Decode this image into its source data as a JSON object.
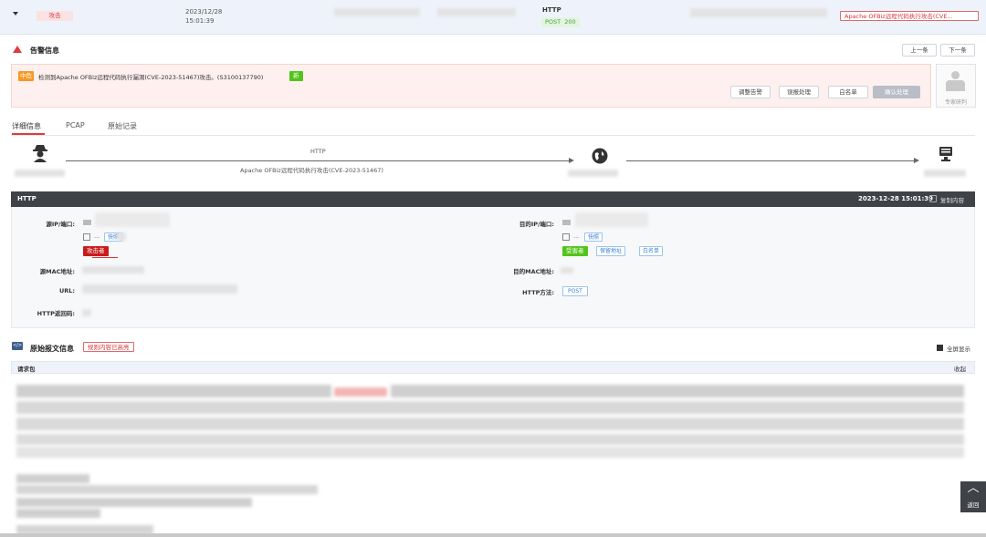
{
  "header_row": {
    "type_badge": "攻击",
    "date": "2023/12/28",
    "time": "15:01:39",
    "protocol": "HTTP",
    "method_status": "POST  200",
    "alert_name": "Apache OFBiz远程代码执行攻击(CVE..."
  },
  "alert": {
    "section_title": "告警信息",
    "prev_label": "上一条",
    "next_label": "下一条",
    "level": "中危",
    "description": "检测到Apache OFBiz远程代码执行漏洞(CVE-2023-51467)攻击。(S3100137790)",
    "new_badge": "新",
    "actions": [
      "调整告警",
      "误报处理",
      "白名单",
      "确认处理"
    ],
    "expert_label": "专家研判"
  },
  "tabs": [
    "详细信息",
    "PCAP",
    "原始记录"
  ],
  "flow": {
    "protocol": "HTTP",
    "attack_name": "Apache OFBiz远程代码执行攻击(CVE-2023-51467)"
  },
  "http_panel": {
    "title": "HTTP",
    "timestamp": "2023-12-28 15:01:39",
    "copy_label": "复制内容",
    "src_ip_label": "源IP/端口:",
    "src_snapshot": "快照",
    "src_ellipsis": "...",
    "attacker_badge": "攻击者",
    "src_mac_label": "源MAC地址:",
    "url_label": "URL:",
    "http_code_label": "HTTP返回码:",
    "dst_ip_label": "目的IP/端口:",
    "dst_snapshot": "快照",
    "dst_ellipsis": "...",
    "victim_badge": "受害者",
    "keep_addr": "保留地址",
    "whitelist": "白名单",
    "dst_mac_label": "目的MAC地址:",
    "http_method_label": "HTTP方法:",
    "http_method": "POST"
  },
  "raw": {
    "title": "原始报文信息",
    "rule_badge": "规则内容已高亮",
    "fullscreen": "全屏显示",
    "request_label": "请求包",
    "collapse": "收起"
  },
  "back_top": {
    "arrow": "︿",
    "label": "返回"
  },
  "colors": {
    "accent_blue": "#3b7fd6",
    "danger_red": "#e03b3b",
    "success_green": "#52c41a",
    "warning_orange": "#f59a23",
    "dark_bar": "#3f4247"
  }
}
